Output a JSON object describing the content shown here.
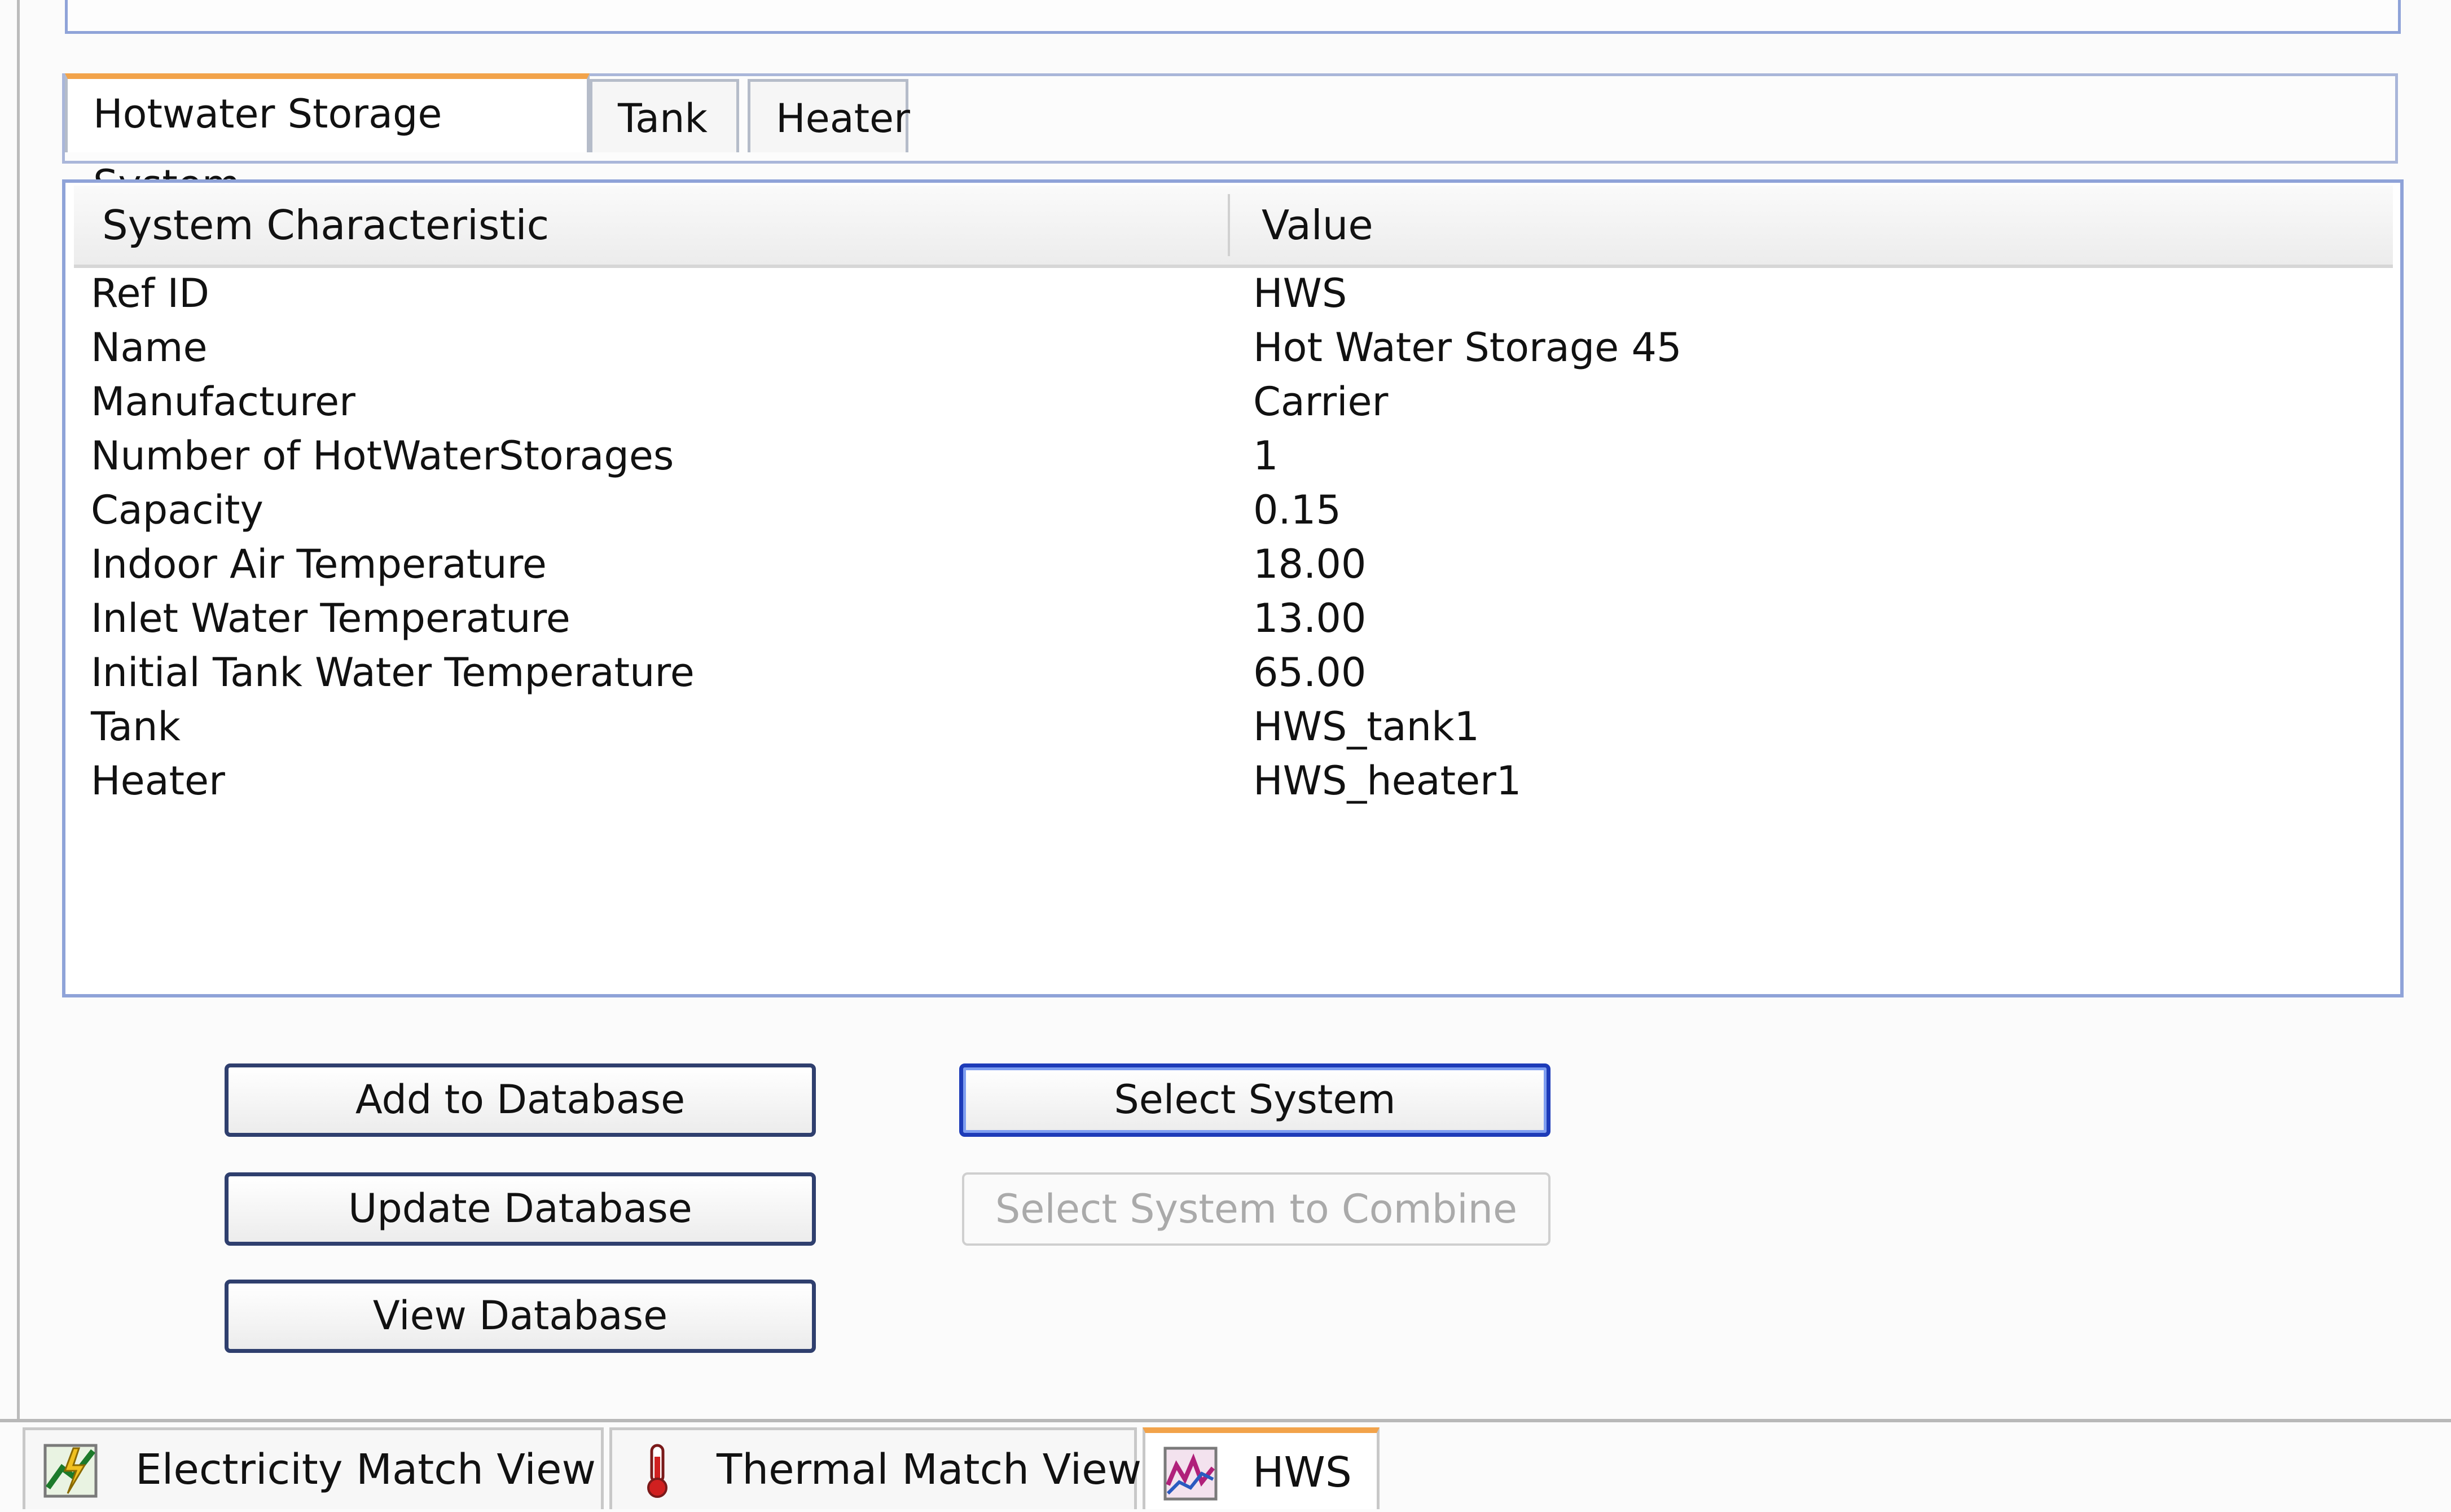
{
  "tabs": [
    "Hotwater Storage System",
    "Tank",
    "Heater"
  ],
  "table": {
    "headers": [
      "System Characteristic",
      "Value"
    ],
    "rows": [
      [
        "Ref ID",
        "HWS"
      ],
      [
        "Name",
        "Hot Water Storage 45"
      ],
      [
        "Manufacturer",
        "Carrier"
      ],
      [
        "Number of HotWaterStorages",
        "1"
      ],
      [
        "Capacity",
        "0.15"
      ],
      [
        "Indoor Air Temperature",
        "18.00"
      ],
      [
        "Inlet Water Temperature",
        "13.00"
      ],
      [
        "Initial Tank Water Temperature",
        "65.00"
      ],
      [
        "Tank",
        "HWS_tank1"
      ],
      [
        "Heater",
        "HWS_heater1"
      ]
    ]
  },
  "buttons": {
    "add": "Add to Database",
    "update": "Update Database",
    "view": "View Database",
    "select": "Select System",
    "combine": "Select System to Combine"
  },
  "bottom_tabs": [
    {
      "label": "Electricity Match View (e)",
      "icon": "electricity-chart-icon"
    },
    {
      "label": "Thermal Match View (t)",
      "icon": "thermometer-icon"
    },
    {
      "label": "HWS",
      "icon": "hws-chart-icon"
    }
  ]
}
